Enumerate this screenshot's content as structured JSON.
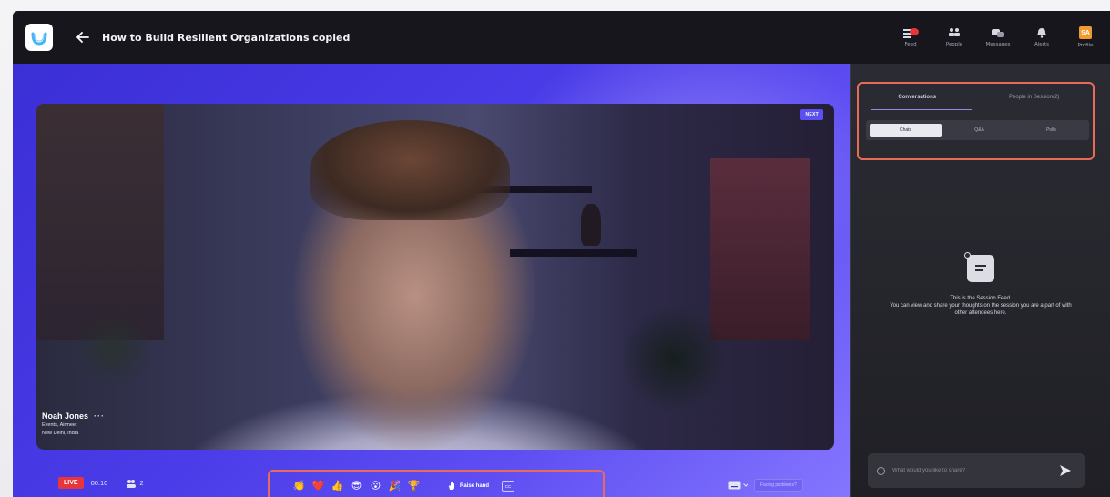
{
  "header": {
    "title": "How to Build Resilient Organizations copied",
    "nav": [
      {
        "label": "Feed"
      },
      {
        "label": "People"
      },
      {
        "label": "Messages"
      },
      {
        "label": "Alerts"
      },
      {
        "label": "Profile"
      }
    ],
    "avatar_initials": "SA"
  },
  "video": {
    "next_badge": "NEXT",
    "speaker_name": "Noah Jones",
    "speaker_menu": "···",
    "speaker_org": "Events, Airmeet",
    "speaker_location": "New Delhi, India"
  },
  "controls": {
    "live_label": "LIVE",
    "timer": "00:10",
    "viewer_count": "2",
    "reactions": [
      "👏",
      "❤️",
      "👍",
      "😎",
      "😮",
      "🎉",
      "🏆"
    ],
    "raise_hand_label": "Raise hand",
    "cc_label": "CC",
    "facing_problems_label": "Facing problems?"
  },
  "sidebar": {
    "tabs": [
      {
        "label": "Conversations"
      },
      {
        "label": "People in Session(2)"
      }
    ],
    "subtabs": [
      {
        "label": "Chats"
      },
      {
        "label": "Q&A"
      },
      {
        "label": "Polls"
      }
    ],
    "empty_title": "This is the Session Feed.",
    "empty_body": "You can view and share your thoughts on the session you are a part of with other attendees here.",
    "input_placeholder": "What would you like to share?"
  },
  "colors": {
    "accent": "#4a3ce8",
    "highlight": "#e86a58",
    "live": "#e8343b"
  }
}
